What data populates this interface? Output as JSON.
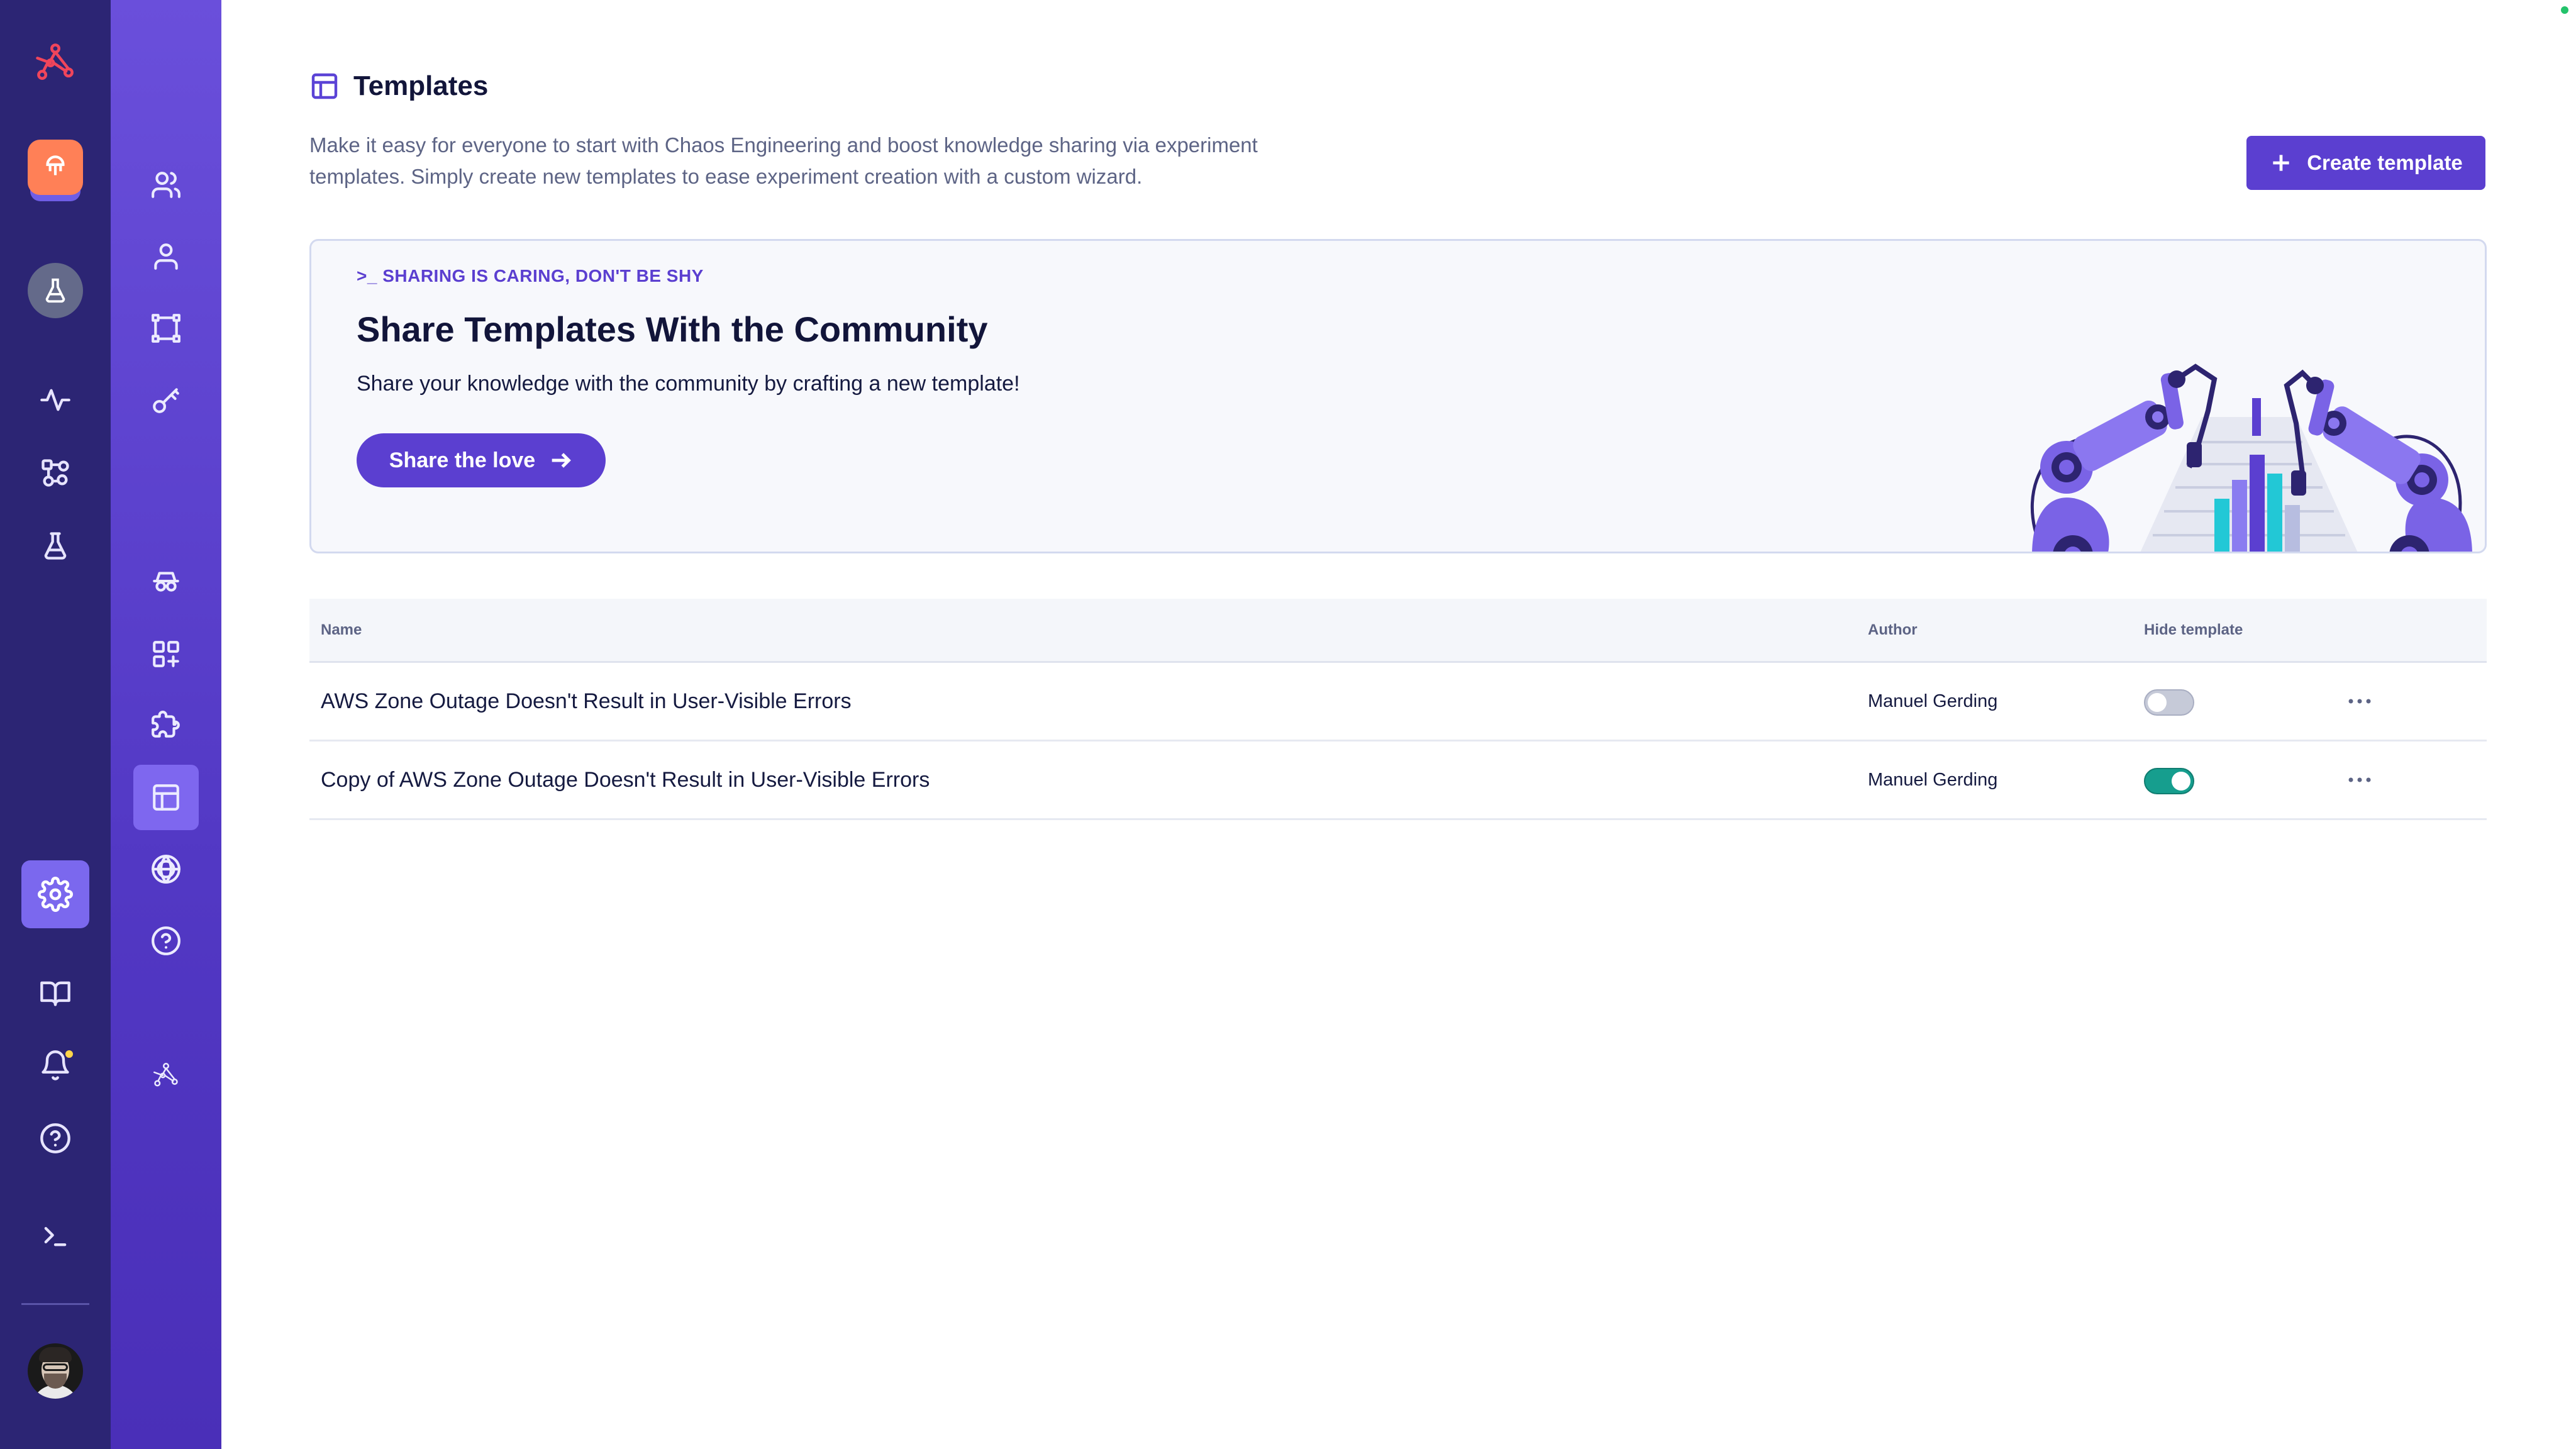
{
  "page": {
    "title": "Templates",
    "description": "Make it easy for everyone to start with Chaos Engineering and boost knowledge sharing via experiment templates. Simply create new templates to ease experiment creation with a custom wizard.",
    "create_label": "Create template"
  },
  "banner": {
    "eyebrow": ">_ SHARING IS CARING, DON'T BE SHY",
    "title": "Share Templates With the Community",
    "text": "Share your knowledge with the community by crafting a new template!",
    "button_label": "Share the love"
  },
  "table": {
    "headers": {
      "name": "Name",
      "author": "Author",
      "hide": "Hide template"
    },
    "rows": [
      {
        "name": "AWS Zone Outage Doesn't Result in User-Visible Errors",
        "author": "Manuel Gerding",
        "hidden": false
      },
      {
        "name": "Copy of AWS Zone Outage Doesn't Result in User-Visible Errors",
        "author": "Manuel Gerding",
        "hidden": true
      }
    ]
  },
  "rail": {
    "items": [
      "logo-icon",
      "team-icon",
      "environment-icon",
      "activity-icon",
      "explore-icon",
      "experiments-icon",
      "settings-icon",
      "docs-icon",
      "notifications-icon",
      "help-icon",
      "terminal-icon",
      "avatar"
    ]
  },
  "subrail": {
    "items": [
      "teams-icon",
      "users-icon",
      "environments-icon",
      "api-tokens-icon",
      "agents-icon",
      "integrations-icon",
      "extensions-icon",
      "templates-icon",
      "hub-icon",
      "support-icon",
      "logo-icon"
    ],
    "active": "templates-icon"
  },
  "colors": {
    "rail_bg": "#2c2574",
    "subrail_bg": "#5b40d0",
    "accent": "#5b3fd0",
    "toggle_on": "#169e8e",
    "team_badge": "#ff8057",
    "logo": "#f0455b"
  }
}
